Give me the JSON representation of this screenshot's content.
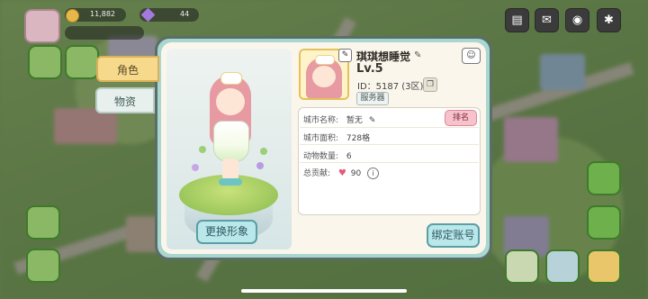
{
  "hud": {
    "coins": "11,882",
    "gems": "44",
    "icons": [
      "notebook-icon",
      "mail-icon",
      "camera-icon",
      "settings-icon"
    ]
  },
  "dialog": {
    "tabs": [
      {
        "label": "角色",
        "active": true
      },
      {
        "label": "物资",
        "active": false
      }
    ],
    "character": {
      "change_button": "更换形象"
    },
    "profile": {
      "name": "琪琪想睡觉",
      "level": "Lv.5",
      "id_text": "ID：5187 (3区)",
      "server_button": "服务器"
    },
    "stats": {
      "city_name_label": "城市名称:",
      "city_name_value": "暂无",
      "rank_button": "排名",
      "area_label": "城市面积:",
      "area_value": "728格",
      "animals_label": "动物数量:",
      "animals_value": "6",
      "contribution_label": "总贡献:",
      "contribution_value": "90"
    },
    "bind_button": "绑定账号"
  },
  "colors": {
    "dialog_border": "#5a6e68",
    "dialog_bg": "#fbf6ec",
    "tab_active": "#f7d98b",
    "button_teal": "#b9e7ea",
    "rank_pink": "#f7c2cb"
  }
}
